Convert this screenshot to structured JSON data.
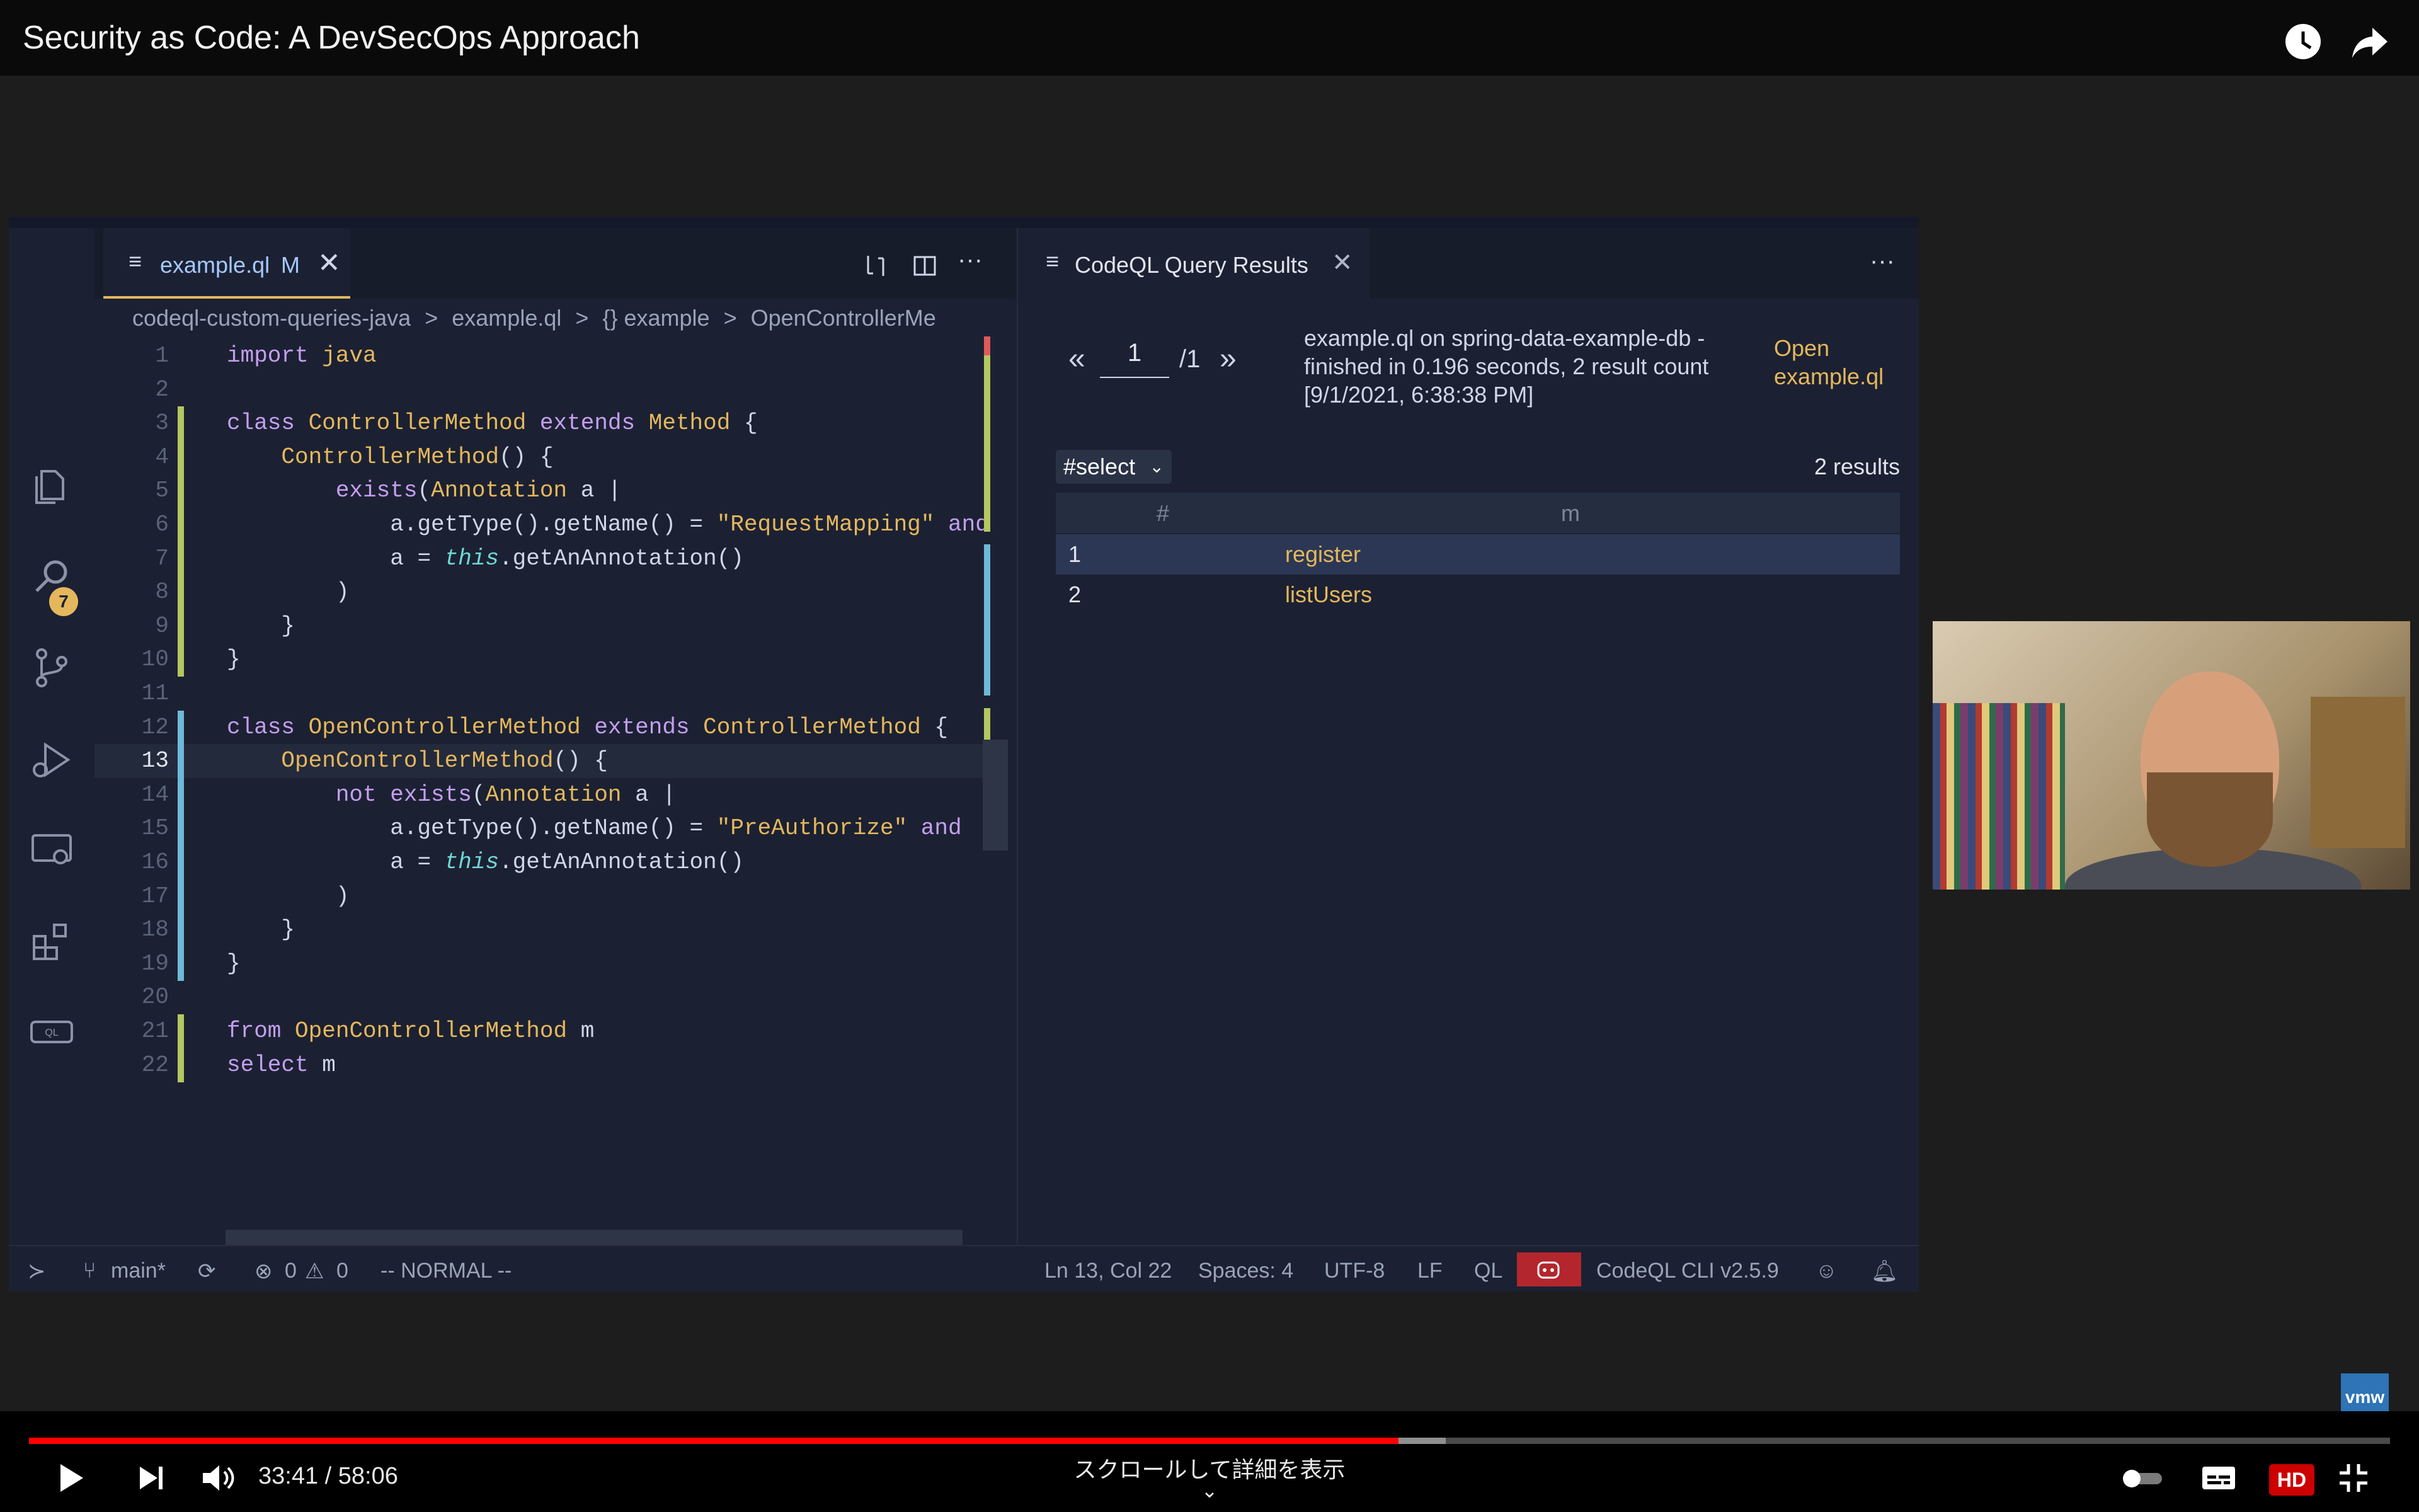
{
  "video": {
    "title": "Security as Code: A DevSecOps Approach",
    "time_current": "33:41",
    "time_sep": " / ",
    "time_total": "58:06",
    "scroll_hint": "スクロールして詳細を表示",
    "progress_fraction": 0.58,
    "buffered_fraction": 0.6,
    "vmw_label": "vmw",
    "hd_label": "HD"
  },
  "editor": {
    "tab_label": "example.ql",
    "tab_modified": "M",
    "breadcrumbs": [
      "codeql-custom-queries-java",
      ">",
      "example.ql",
      ">",
      "{} example",
      ">",
      "OpenControllerMe"
    ],
    "scm_badge": "7",
    "lines": [
      {
        "n": "1",
        "tokens": [
          [
            "kw",
            "import"
          ],
          [
            "pl",
            " "
          ],
          [
            "ty",
            "java"
          ]
        ]
      },
      {
        "n": "2",
        "tokens": []
      },
      {
        "n": "3",
        "tokens": [
          [
            "kw",
            "class"
          ],
          [
            "pl",
            " "
          ],
          [
            "ty",
            "ControllerMethod"
          ],
          [
            "pl",
            " "
          ],
          [
            "kw",
            "extends"
          ],
          [
            "pl",
            " "
          ],
          [
            "ty",
            "Method"
          ],
          [
            "pl",
            " {"
          ]
        ]
      },
      {
        "n": "4",
        "tokens": [
          [
            "pl",
            "    "
          ],
          [
            "ty",
            "ControllerMethod"
          ],
          [
            "pl",
            "() {"
          ]
        ]
      },
      {
        "n": "5",
        "tokens": [
          [
            "pl",
            "        "
          ],
          [
            "kw",
            "exists"
          ],
          [
            "pl",
            "("
          ],
          [
            "ty",
            "Annotation"
          ],
          [
            "pl",
            " a |"
          ]
        ]
      },
      {
        "n": "6",
        "tokens": [
          [
            "pl",
            "            a.getType().getName() = "
          ],
          [
            "st",
            "\"RequestMapping\""
          ],
          [
            "pl",
            " "
          ],
          [
            "kw",
            "and"
          ]
        ]
      },
      {
        "n": "7",
        "tokens": [
          [
            "pl",
            "            a = "
          ],
          [
            "it",
            "this"
          ],
          [
            "pl",
            ".getAnAnnotation()"
          ]
        ]
      },
      {
        "n": "8",
        "tokens": [
          [
            "pl",
            "        )"
          ]
        ]
      },
      {
        "n": "9",
        "tokens": [
          [
            "pl",
            "    }"
          ]
        ]
      },
      {
        "n": "10",
        "tokens": [
          [
            "pl",
            "}"
          ]
        ]
      },
      {
        "n": "11",
        "tokens": []
      },
      {
        "n": "12",
        "tokens": [
          [
            "kw",
            "class"
          ],
          [
            "pl",
            " "
          ],
          [
            "ty",
            "OpenControllerMethod"
          ],
          [
            "pl",
            " "
          ],
          [
            "kw",
            "extends"
          ],
          [
            "pl",
            " "
          ],
          [
            "ty",
            "ControllerMethod"
          ],
          [
            "pl",
            " {"
          ]
        ]
      },
      {
        "n": "13",
        "tokens": [
          [
            "pl",
            "    "
          ],
          [
            "ty",
            "OpenControllerMethod"
          ],
          [
            "pl",
            "() {"
          ]
        ]
      },
      {
        "n": "14",
        "tokens": [
          [
            "pl",
            "        "
          ],
          [
            "kw",
            "not exists"
          ],
          [
            "pl",
            "("
          ],
          [
            "ty",
            "Annotation"
          ],
          [
            "pl",
            " a |"
          ]
        ]
      },
      {
        "n": "15",
        "tokens": [
          [
            "pl",
            "            a.getType().getName() = "
          ],
          [
            "st",
            "\"PreAuthorize\""
          ],
          [
            "pl",
            " "
          ],
          [
            "kw",
            "and"
          ]
        ]
      },
      {
        "n": "16",
        "tokens": [
          [
            "pl",
            "            a = "
          ],
          [
            "it",
            "this"
          ],
          [
            "pl",
            ".getAnAnnotation()"
          ]
        ]
      },
      {
        "n": "17",
        "tokens": [
          [
            "pl",
            "        )"
          ]
        ]
      },
      {
        "n": "18",
        "tokens": [
          [
            "pl",
            "    }"
          ]
        ]
      },
      {
        "n": "19",
        "tokens": [
          [
            "pl",
            "}"
          ]
        ]
      },
      {
        "n": "20",
        "tokens": []
      },
      {
        "n": "21",
        "tokens": [
          [
            "kw",
            "from"
          ],
          [
            "pl",
            " "
          ],
          [
            "ty",
            "OpenControllerMethod"
          ],
          [
            "pl",
            " m"
          ]
        ]
      },
      {
        "n": "22",
        "tokens": [
          [
            "kw",
            "select"
          ],
          [
            "pl",
            " m"
          ]
        ]
      }
    ]
  },
  "results": {
    "tab_label": "CodeQL Query Results",
    "page_prev": "«",
    "page_current": "1",
    "page_total": "/1",
    "page_next": "»",
    "meta": "example.ql on spring-data-example-db - finished in 0.196 seconds, 2 result count [9/1/2021, 6:38:38 PM]",
    "open_link": "Open example.ql",
    "selector": "#select",
    "count": "2 results",
    "columns": [
      "#",
      "m"
    ],
    "rows": [
      {
        "idx": "1",
        "value": "register"
      },
      {
        "idx": "2",
        "value": "listUsers"
      }
    ]
  },
  "statusbar": {
    "branch": "main*",
    "errors": "0",
    "warnings": "0",
    "mode": "-- NORMAL --",
    "position": "Ln 13, Col 22",
    "spaces": "Spaces: 4",
    "encoding": "UTF-8",
    "eol": "LF",
    "language": "QL",
    "cli": "CodeQL CLI v2.5.9"
  },
  "colors": {
    "accent": "#e5b75d",
    "progress": "#ff0000",
    "editor_bg": "#1b2132"
  }
}
